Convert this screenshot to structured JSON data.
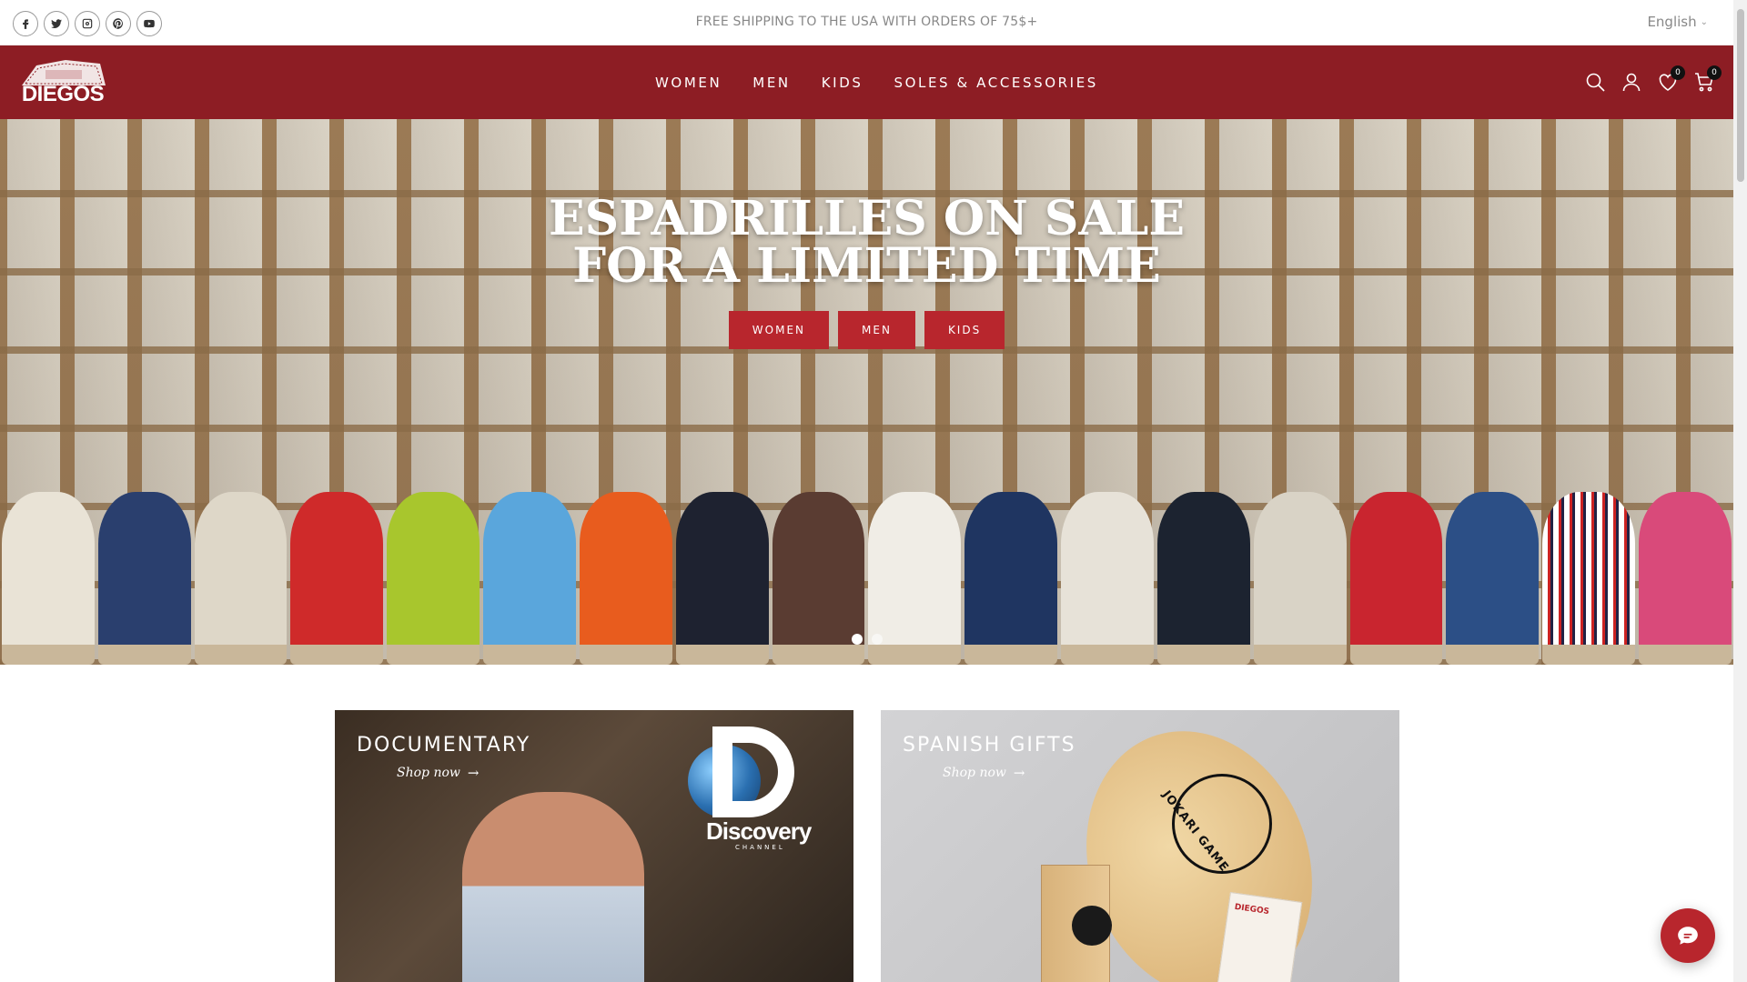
{
  "topbar": {
    "announcement": "FREE SHIPPING TO THE USA WITH ORDERS OF 75$+",
    "language": "English",
    "socials": [
      "facebook-icon",
      "twitter-icon",
      "instagram-icon",
      "pinterest-icon",
      "youtube-icon"
    ]
  },
  "header": {
    "logo_text": "DIEGOS",
    "nav": [
      {
        "label": "WOMEN"
      },
      {
        "label": "MEN"
      },
      {
        "label": "KIDS"
      },
      {
        "label": "SOLES & ACCESSORIES"
      }
    ],
    "wishlist_count": "0",
    "cart_count": "0"
  },
  "hero": {
    "title_line1": "ESPADRILLES ON SALE",
    "title_line2": "FOR A LIMITED TIME",
    "buttons": [
      {
        "label": "WOMEN"
      },
      {
        "label": "MEN"
      },
      {
        "label": "KIDS"
      }
    ],
    "slides_total": 2,
    "slide_active": 1
  },
  "tiles": [
    {
      "title": "DOCUMENTARY",
      "link": "Shop now",
      "brand": "Discovery",
      "brand_sub": "CHANNEL"
    },
    {
      "title": "SPANISH GIFTS",
      "link": "Shop now",
      "paddle_text": "JOKARI GAME",
      "card_title": "DIEGOS"
    }
  ],
  "colors": {
    "header_bg": "#8d1d24",
    "button_bg": "#b8262d",
    "chat_bg": "#b8262d"
  }
}
